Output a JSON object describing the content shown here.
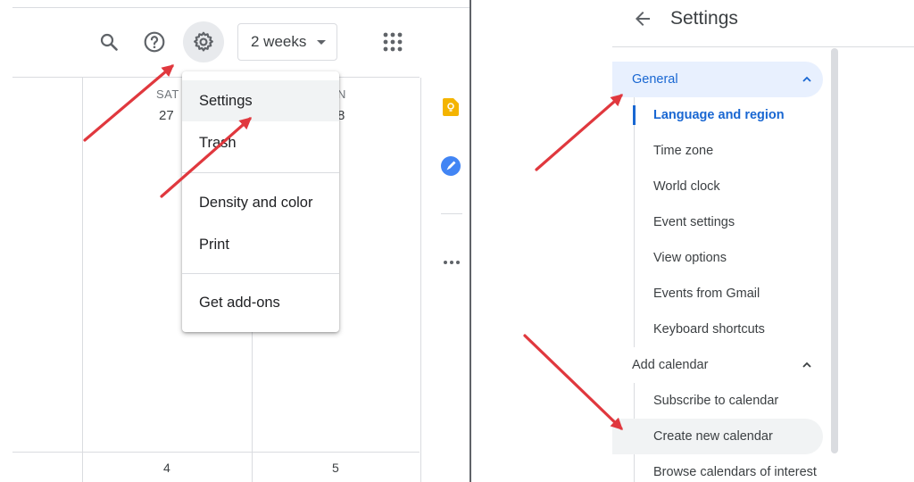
{
  "toolbar": {
    "view_selector": "2 weeks",
    "icons": [
      "search-icon",
      "help-icon",
      "gear-icon",
      "apps-grid-icon"
    ]
  },
  "calendar": {
    "day_labels": [
      "SAT",
      "N"
    ],
    "day_numbers_top": [
      "27",
      "8"
    ],
    "day_numbers_bottom": [
      "4",
      "5"
    ]
  },
  "settings_menu": {
    "items": [
      "Settings",
      "Trash",
      "Density and color",
      "Print",
      "Get add-ons"
    ]
  },
  "settings_page": {
    "title": "Settings",
    "general_label": "General",
    "general_items": [
      "Language and region",
      "Time zone",
      "World clock",
      "Event settings",
      "View options",
      "Events from Gmail",
      "Keyboard shortcuts"
    ],
    "add_calendar_label": "Add calendar",
    "add_calendar_items": [
      "Subscribe to calendar",
      "Create new calendar",
      "Browse calendars of interest"
    ]
  },
  "colors": {
    "accent_blue": "#1967d2",
    "highlight_bg": "#e8f0fe",
    "annotation_arrow": "#e0383e",
    "keep_yellow": "#f4b400",
    "tasks_blue": "#4285f4"
  }
}
